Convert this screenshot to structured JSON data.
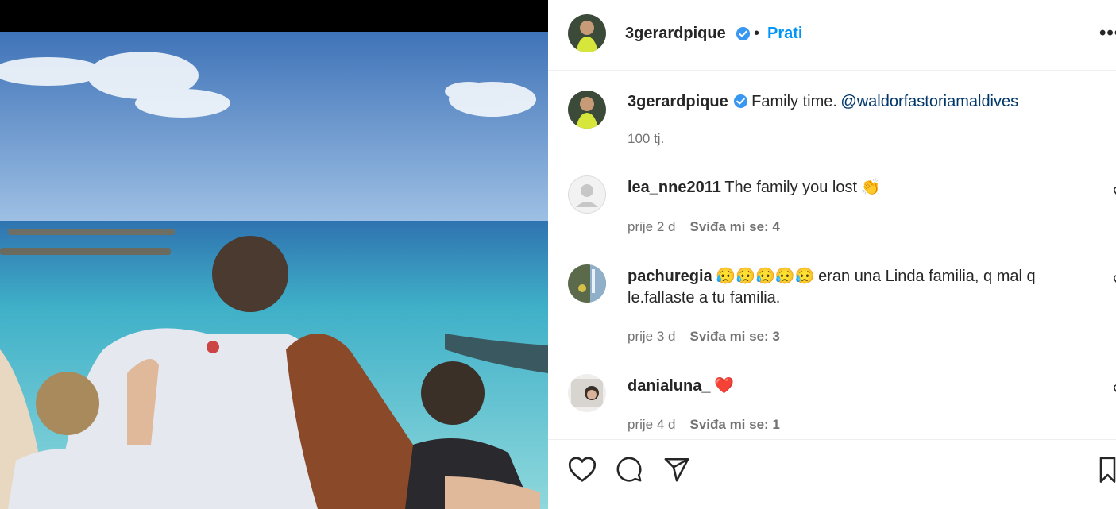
{
  "post": {
    "username": "3gerardpique",
    "separator": "•",
    "follow_label": "Prati",
    "more_label": "•••"
  },
  "caption": {
    "username": "3gerardpique",
    "text": "Family time.",
    "mention": "@waldorfastoriamaldives",
    "time": "100 tj."
  },
  "comments": [
    {
      "username": "lea_nne2011",
      "text": "The family you lost",
      "emoji": "👏",
      "time": "prije 2 d",
      "likes": "Sviđa mi se: 4"
    },
    {
      "username": "pachuregia",
      "emoji": "😥😥😥😥😥",
      "text": "eran una Linda familia, q mal q le.fallaste a tu familia.",
      "time": "prije 3 d",
      "likes": "Sviđa mi se: 3"
    },
    {
      "username": "danialuna_",
      "emoji": "❤️",
      "text": "",
      "time": "prije 4 d",
      "likes": "Sviđa mi se: 1"
    }
  ],
  "colors": {
    "accent": "#0095f6",
    "verified": "#3897f0",
    "mention": "#00376b",
    "muted": "#737373"
  },
  "icons": [
    "verified-badge-icon",
    "heart-icon",
    "comment-icon",
    "share-icon",
    "bookmark-icon",
    "more-icon"
  ]
}
